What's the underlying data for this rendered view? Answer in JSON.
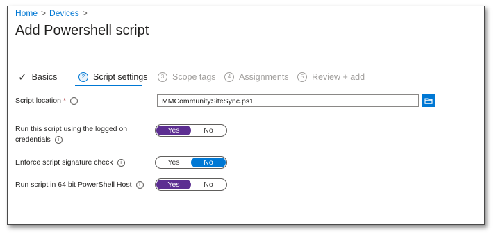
{
  "breadcrumb": {
    "items": [
      "Home",
      "Devices"
    ]
  },
  "page": {
    "title": "Add Powershell script"
  },
  "wizard": {
    "steps": [
      {
        "num": "",
        "label": "Basics",
        "state": "done"
      },
      {
        "num": "2",
        "label": "Script settings",
        "state": "active"
      },
      {
        "num": "3",
        "label": "Scope tags",
        "state": "pending"
      },
      {
        "num": "4",
        "label": "Assignments",
        "state": "pending"
      },
      {
        "num": "5",
        "label": "Review + add",
        "state": "pending"
      }
    ]
  },
  "form": {
    "script_location": {
      "label": "Script location",
      "required_mark": "*",
      "value": "MMCommunitySiteSync.ps1",
      "browse_icon": "folder-icon"
    },
    "run_as_logged_on": {
      "label": "Run this script using the logged on credentials",
      "options": [
        "Yes",
        "No"
      ],
      "selected": "Yes"
    },
    "signature_check": {
      "label": "Enforce script signature check",
      "options": [
        "Yes",
        "No"
      ],
      "selected": "No"
    },
    "run_64bit": {
      "label": "Run script in 64 bit PowerShell Host",
      "options": [
        "Yes",
        "No"
      ],
      "selected": "Yes"
    }
  },
  "colors": {
    "accent": "#0078d4",
    "toggle_selected": "#5c2e91",
    "required": "#a4262c"
  }
}
